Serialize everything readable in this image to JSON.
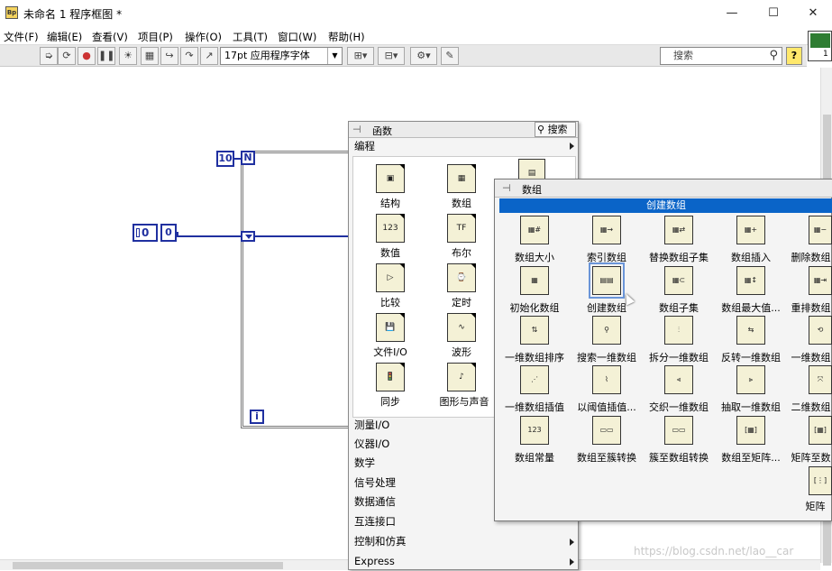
{
  "window": {
    "title": "未命名 1 程序框图 *",
    "app_icon_text": "Bp",
    "minimize": "—",
    "maximize": "☐",
    "close": "✕"
  },
  "menu": [
    "文件(F)",
    "编辑(E)",
    "查看(V)",
    "项目(P)",
    "操作(O)",
    "工具(T)",
    "窗口(W)",
    "帮助(H)"
  ],
  "toolbar": {
    "font": "17pt 应用程序字体",
    "search_placeholder": "搜索",
    "help": "?"
  },
  "vi_icon_num": "1",
  "diagram": {
    "loop_count_const": "10",
    "loop_n": "N",
    "loop_i": "i",
    "control_value": "0",
    "indicator_value": "0"
  },
  "functions_palette": {
    "title": "函数",
    "search": "搜索",
    "category": "编程",
    "grid_items": [
      {
        "label": "结构",
        "icon": "structures-icon"
      },
      {
        "label": "数组",
        "icon": "array-icon"
      },
      {
        "label": "数值",
        "icon": "numeric-icon"
      },
      {
        "label": "布尔",
        "icon": "boolean-icon"
      },
      {
        "label": "比较",
        "icon": "comparison-icon"
      },
      {
        "label": "定时",
        "icon": "timing-icon"
      },
      {
        "label": "文件I/O",
        "icon": "file-io-icon"
      },
      {
        "label": "波形",
        "icon": "waveform-icon"
      },
      {
        "label": "同步",
        "icon": "sync-icon"
      },
      {
        "label": "图形与声音",
        "icon": "graphics-sound-icon"
      }
    ],
    "categories": [
      {
        "label": "测量I/O",
        "submenu": false
      },
      {
        "label": "仪器I/O",
        "submenu": false
      },
      {
        "label": "数学",
        "submenu": false
      },
      {
        "label": "信号处理",
        "submenu": false
      },
      {
        "label": "数据通信",
        "submenu": false
      },
      {
        "label": "互连接口",
        "submenu": false
      },
      {
        "label": "控制和仿真",
        "submenu": true
      },
      {
        "label": "Express",
        "submenu": true
      }
    ]
  },
  "array_palette": {
    "title": "数组",
    "selected_label": "创建数组",
    "items": [
      {
        "label": "数组大小",
        "icon": "array-size-icon"
      },
      {
        "label": "索引数组",
        "icon": "index-array-icon"
      },
      {
        "label": "替换数组子集",
        "icon": "replace-subset-icon"
      },
      {
        "label": "数组插入",
        "icon": "insert-array-icon"
      },
      {
        "label": "删除数组",
        "icon": "delete-array-icon"
      },
      {
        "label": "初始化数组",
        "icon": "initialize-array-icon"
      },
      {
        "label": "创建数组",
        "icon": "build-array-icon",
        "selected": true
      },
      {
        "label": "数组子集",
        "icon": "array-subset-icon"
      },
      {
        "label": "数组最大值...",
        "icon": "array-max-min-icon"
      },
      {
        "label": "重排数组",
        "icon": "reshape-array-icon"
      },
      {
        "label": "一维数组排序",
        "icon": "sort-1d-icon"
      },
      {
        "label": "搜索一维数组",
        "icon": "search-1d-icon"
      },
      {
        "label": "拆分一维数组",
        "icon": "split-1d-icon"
      },
      {
        "label": "反转一维数组",
        "icon": "reverse-1d-icon"
      },
      {
        "label": "一维数组",
        "icon": "rotate-1d-icon"
      },
      {
        "label": "一维数组插值",
        "icon": "interpolate-1d-icon"
      },
      {
        "label": "以阈值插值...",
        "icon": "threshold-1d-icon"
      },
      {
        "label": "交织一维数组",
        "icon": "interleave-1d-icon"
      },
      {
        "label": "抽取一维数组",
        "icon": "decimate-1d-icon"
      },
      {
        "label": "二维数组",
        "icon": "transpose-2d-icon"
      },
      {
        "label": "数组常量",
        "icon": "array-constant-icon"
      },
      {
        "label": "数组至簇转换",
        "icon": "array-to-cluster-icon"
      },
      {
        "label": "簇至数组转换",
        "icon": "cluster-to-array-icon"
      },
      {
        "label": "数组至矩阵...",
        "icon": "array-to-matrix-icon"
      },
      {
        "label": "矩阵至数",
        "icon": "matrix-to-array-icon"
      },
      {
        "label": "矩阵",
        "icon": "matrix-icon"
      }
    ]
  },
  "watermark": "https://blog.csdn.net/lao__car"
}
